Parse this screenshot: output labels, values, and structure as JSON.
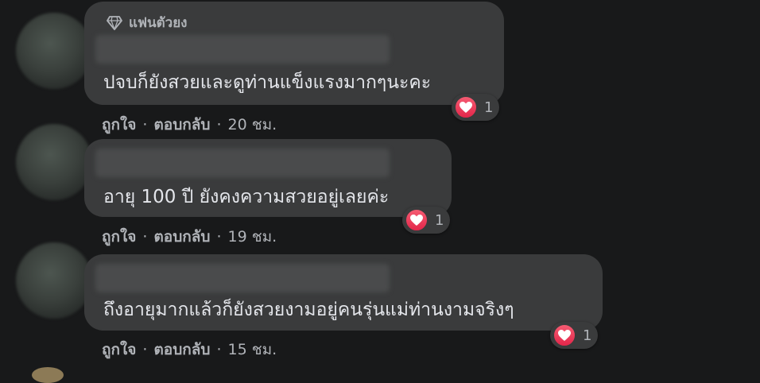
{
  "comments": [
    {
      "badge": "แฟนตัวยง",
      "text": "ปจบก็ยังสวยและดูท่านแข็งแรงมากๆนะคะ",
      "reaction_count": "1",
      "like": "ถูกใจ",
      "reply": "ตอบกลับ",
      "time": "20 ชม."
    },
    {
      "badge": "",
      "text": "อายุ 100 ปี ยังคงความสวยอยู่เลยค่ะ",
      "reaction_count": "1",
      "like": "ถูกใจ",
      "reply": "ตอบกลับ",
      "time": "19 ชม."
    },
    {
      "badge": "",
      "text": "ถึงอายุมากแล้วก็ยังสวยงามอยู่คนรุ่นแม่ท่านงามจริงๆ",
      "reaction_count": "1",
      "like": "ถูกใจ",
      "reply": "ตอบกลับ",
      "time": "15 ชม."
    }
  ],
  "separator": "·",
  "colors": {
    "background": "#18191a",
    "bubble": "#3a3b3c",
    "text": "#e4e6eb",
    "meta": "#b0b3b8",
    "heart": "#e3264a"
  }
}
